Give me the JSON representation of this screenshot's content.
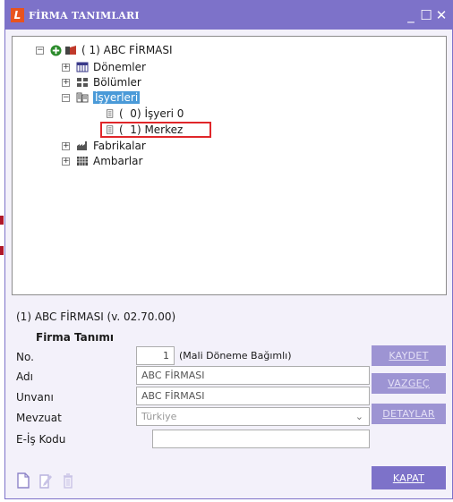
{
  "window": {
    "title": "FİRMA TANIMLARI",
    "logo_letter": "L"
  },
  "tree": {
    "root": "( 1) ABC FİRMASI",
    "items": [
      {
        "label": "Dönemler",
        "expander": "+"
      },
      {
        "label": "Bölümler",
        "expander": "+"
      },
      {
        "label": "İşyerleri",
        "expander": "−"
      },
      {
        "label": "(  0) İşyeri 0"
      },
      {
        "label": "(  1) Merkez"
      },
      {
        "label": "Fabrikalar",
        "expander": "+"
      },
      {
        "label": "Ambarlar",
        "expander": "+"
      }
    ],
    "root_expander": "−"
  },
  "info": {
    "firm_version": "(1) ABC FİRMASI  (v. 02.70.00)"
  },
  "form": {
    "section_title": "Firma Tanımı",
    "no_label": "No.",
    "no_value": "1",
    "no_note": "(Mali Döneme Bağımlı)",
    "adi_label": "Adı",
    "adi_value": "ABC FİRMASI",
    "unvani_label": "Unvanı",
    "unvani_value": "ABC FİRMASI",
    "mevzuat_label": "Mevzuat",
    "mevzuat_value": "Türkiye",
    "eis_label": "E-İş Kodu",
    "eis_value": ""
  },
  "buttons": {
    "kaydet": "KAYDET",
    "vazgec": "VAZGEÇ",
    "detaylar": "DETAYLAR",
    "kapat": "KAPAT"
  },
  "colors": {
    "accent": "#7d72c9",
    "button_disabled": "#9d94d3",
    "selection": "#4a9ad8",
    "highlight": "#e0262a"
  }
}
